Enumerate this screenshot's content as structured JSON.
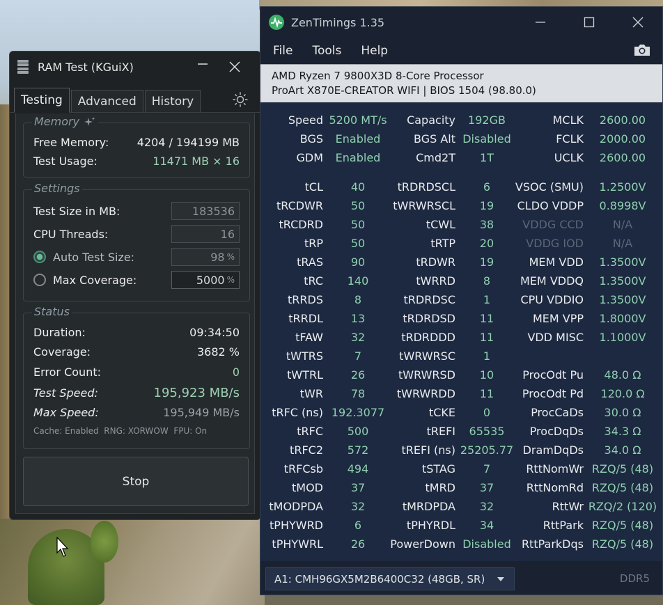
{
  "ram_test": {
    "title": "RAM Test (KGuiX)",
    "tabs": [
      "Testing",
      "Advanced",
      "History"
    ],
    "memory": {
      "label": "Memory",
      "free_memory_label": "Free Memory:",
      "free_memory_value": "4204 / 194199 MB",
      "test_usage_label": "Test Usage:",
      "test_usage_value": "11471 MB × 16"
    },
    "settings": {
      "label": "Settings",
      "test_size_label": "Test Size in MB:",
      "test_size_value": "183536",
      "cpu_threads_label": "CPU Threads:",
      "cpu_threads_value": "16",
      "auto_test_size_label": "Auto Test Size:",
      "auto_test_size_value": "98",
      "max_coverage_label": "Max Coverage:",
      "max_coverage_value": "5000",
      "percent_unit": "%"
    },
    "status": {
      "label": "Status",
      "duration_label": "Duration:",
      "duration_value": "09:34:50",
      "coverage_label": "Coverage:",
      "coverage_value": "3682 %",
      "error_count_label": "Error Count:",
      "error_count_value": "0",
      "test_speed_label": "Test Speed:",
      "test_speed_value": "195,923 MB/s",
      "max_speed_label": "Max Speed:",
      "max_speed_value": "195,949 MB/s",
      "info_line": "Cache: Enabled  RNG: XORWOW  FPU: On"
    },
    "stop_label": "Stop"
  },
  "zen": {
    "title": "ZenTimings 1.35",
    "menu": [
      "File",
      "Tools",
      "Help"
    ],
    "cpu": "AMD Ryzen 7 9800X3D 8-Core Processor",
    "board": "ProArt X870E-CREATOR WIFI | BIOS 1504 (98.80.0)",
    "rows": [
      [
        [
          "Speed",
          "5200 MT/s"
        ],
        [
          "Capacity",
          "192GB"
        ],
        [
          "MCLK",
          "2600.00"
        ]
      ],
      [
        [
          "BGS",
          "Enabled"
        ],
        [
          "BGS Alt",
          "Disabled"
        ],
        [
          "FCLK",
          "2000.00"
        ]
      ],
      [
        [
          "GDM",
          "Enabled"
        ],
        [
          "Cmd2T",
          "1T"
        ],
        [
          "UCLK",
          "2600.00"
        ]
      ],
      [
        [
          "tCL",
          "40"
        ],
        [
          "tRDRDSCL",
          "6"
        ],
        [
          "VSOC (SMU)",
          "1.2500V"
        ]
      ],
      [
        [
          "tRCDWR",
          "50"
        ],
        [
          "tWRWRSCL",
          "19"
        ],
        [
          "CLDO VDDP",
          "0.8998V"
        ]
      ],
      [
        [
          "tRCDRD",
          "50"
        ],
        [
          "tCWL",
          "38"
        ],
        [
          "VDDG CCD",
          "N/A"
        ]
      ],
      [
        [
          "tRP",
          "50"
        ],
        [
          "tRTP",
          "20"
        ],
        [
          "VDDG IOD",
          "N/A"
        ]
      ],
      [
        [
          "tRAS",
          "90"
        ],
        [
          "tRDWR",
          "19"
        ],
        [
          "MEM VDD",
          "1.3500V"
        ]
      ],
      [
        [
          "tRC",
          "140"
        ],
        [
          "tWRRD",
          "8"
        ],
        [
          "MEM VDDQ",
          "1.3500V"
        ]
      ],
      [
        [
          "tRRDS",
          "8"
        ],
        [
          "tRDRDSC",
          "1"
        ],
        [
          "CPU VDDIO",
          "1.3500V"
        ]
      ],
      [
        [
          "tRRDL",
          "13"
        ],
        [
          "tRDRDSD",
          "11"
        ],
        [
          "MEM VPP",
          "1.8000V"
        ]
      ],
      [
        [
          "tFAW",
          "32"
        ],
        [
          "tRDRDDD",
          "11"
        ],
        [
          "VDD MISC",
          "1.1000V"
        ]
      ],
      [
        [
          "tWTRS",
          "7"
        ],
        [
          "tWRWRSC",
          "1"
        ],
        [
          "",
          ""
        ]
      ],
      [
        [
          "tWTRL",
          "26"
        ],
        [
          "tWRWRSD",
          "10"
        ],
        [
          "ProcOdt Pu",
          "48.0 Ω"
        ]
      ],
      [
        [
          "tWR",
          "78"
        ],
        [
          "tWRWRDD",
          "11"
        ],
        [
          "ProcOdt Pd",
          "120.0 Ω"
        ]
      ],
      [
        [
          "tRFC (ns)",
          "192.3077"
        ],
        [
          "tCKE",
          "0"
        ],
        [
          "ProcCaDs",
          "30.0 Ω"
        ]
      ],
      [
        [
          "tRFC",
          "500"
        ],
        [
          "tREFI",
          "65535"
        ],
        [
          "ProcDqDs",
          "34.3 Ω"
        ]
      ],
      [
        [
          "tRFC2",
          "572"
        ],
        [
          "tREFI (ns)",
          "25205.77"
        ],
        [
          "DramDqDs",
          "34.0 Ω"
        ]
      ],
      [
        [
          "tRFCsb",
          "494"
        ],
        [
          "tSTAG",
          "7"
        ],
        [
          "RttNomWr",
          "RZQ/5 (48)"
        ]
      ],
      [
        [
          "tMOD",
          "37"
        ],
        [
          "tMRD",
          "37"
        ],
        [
          "RttNomRd",
          "RZQ/5 (48)"
        ]
      ],
      [
        [
          "tMODPDA",
          "32"
        ],
        [
          "tMRDPDA",
          "32"
        ],
        [
          "RttWr",
          "RZQ/2 (120)"
        ]
      ],
      [
        [
          "tPHYWRD",
          "6"
        ],
        [
          "tPHYRDL",
          "34"
        ],
        [
          "RttPark",
          "RZQ/5 (48)"
        ]
      ],
      [
        [
          "tPHYWRL",
          "26"
        ],
        [
          "PowerDown",
          "Disabled"
        ],
        [
          "RttParkDqs",
          "RZQ/5 (48)"
        ]
      ]
    ],
    "dimm": "A1: CMH96GX5M2B6400C32 (48GB, SR)",
    "ddr": "DDR5"
  }
}
